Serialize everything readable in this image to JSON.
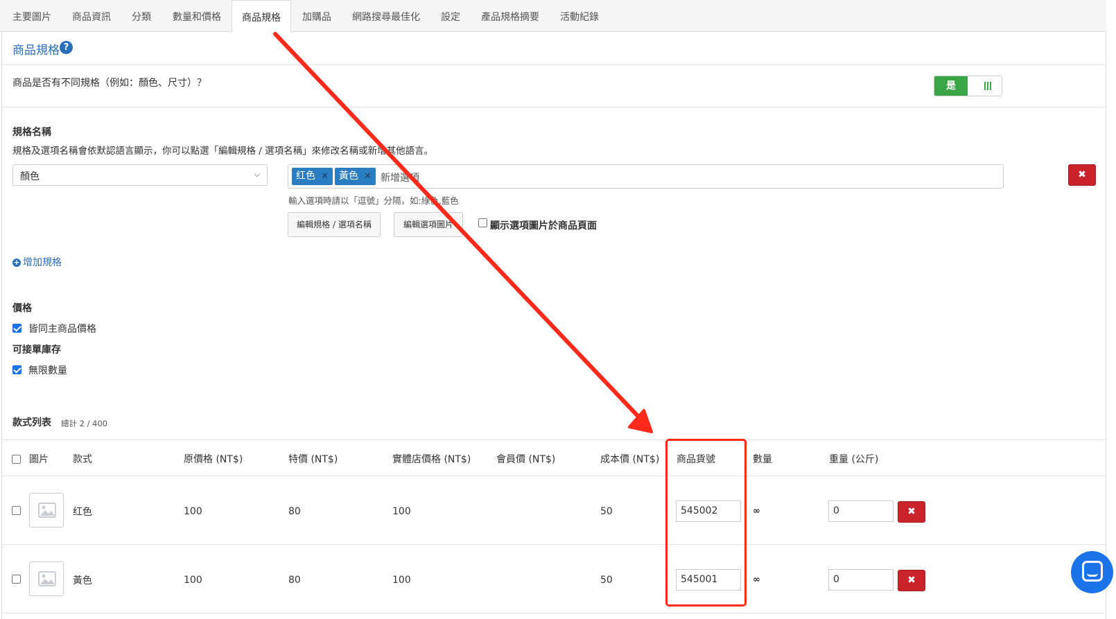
{
  "tabs": [
    "主要圖片",
    "商品資訊",
    "分類",
    "數量和價格",
    "商品規格",
    "加購品",
    "網路搜尋最佳化",
    "設定",
    "產品規格摘要",
    "活動紀錄"
  ],
  "active_tab_index": 4,
  "section": {
    "title": "商品規格",
    "help": "?"
  },
  "variation_question": "商品是否有不同規格（例如：顏色、尺寸）？",
  "toggle": {
    "on_label": "是",
    "state": "on"
  },
  "spec_name": {
    "label": "規格名稱",
    "help": "規格及選項名稱會依默認語言顯示，你可以點選「編輯規格 / 選項名稱」來修改名稱或新增其他語言。",
    "selected": "顏色",
    "options": [
      "红色",
      "黃色"
    ],
    "add_option_placeholder": "新增選項",
    "hint": "輸入選項時請以「逗號」分隔，如:綠色,藍色",
    "edit_names_button": "編輯規格 / 選項名稱",
    "edit_images_button": "編輯選項圖片",
    "show_images_label": "顯示選項圖片於商品頁面"
  },
  "add_spec": "增加規格",
  "price": {
    "label": "價格",
    "same_as_main": "皆同主商品價格",
    "checked": true
  },
  "stock": {
    "label": "可接單庫存",
    "unlimited": "無限數量",
    "checked": true
  },
  "variants": {
    "title": "款式列表",
    "total": "總計 2 / 400",
    "columns": [
      "圖片",
      "款式",
      "原價格 (NT$)",
      "特價 (NT$)",
      "實體店價格 (NT$)",
      "會員價 (NT$)",
      "成本價 (NT$)",
      "商品貨號",
      "數量",
      "重量 (公斤)"
    ],
    "rows": [
      {
        "name": "红色",
        "price": "100",
        "sale": "80",
        "retail": "100",
        "member": "",
        "cost": "50",
        "sku": "545002",
        "qty": "∞",
        "weight": "0"
      },
      {
        "name": "黃色",
        "price": "100",
        "sale": "80",
        "retail": "100",
        "member": "",
        "cost": "50",
        "sku": "545001",
        "qty": "∞",
        "weight": "0"
      }
    ]
  },
  "colors": {
    "accent": "#2a6ebb",
    "danger": "#c9242c",
    "success": "#3aa647",
    "annotation": "#ff2a1a",
    "tag": "#2a7dc0"
  }
}
